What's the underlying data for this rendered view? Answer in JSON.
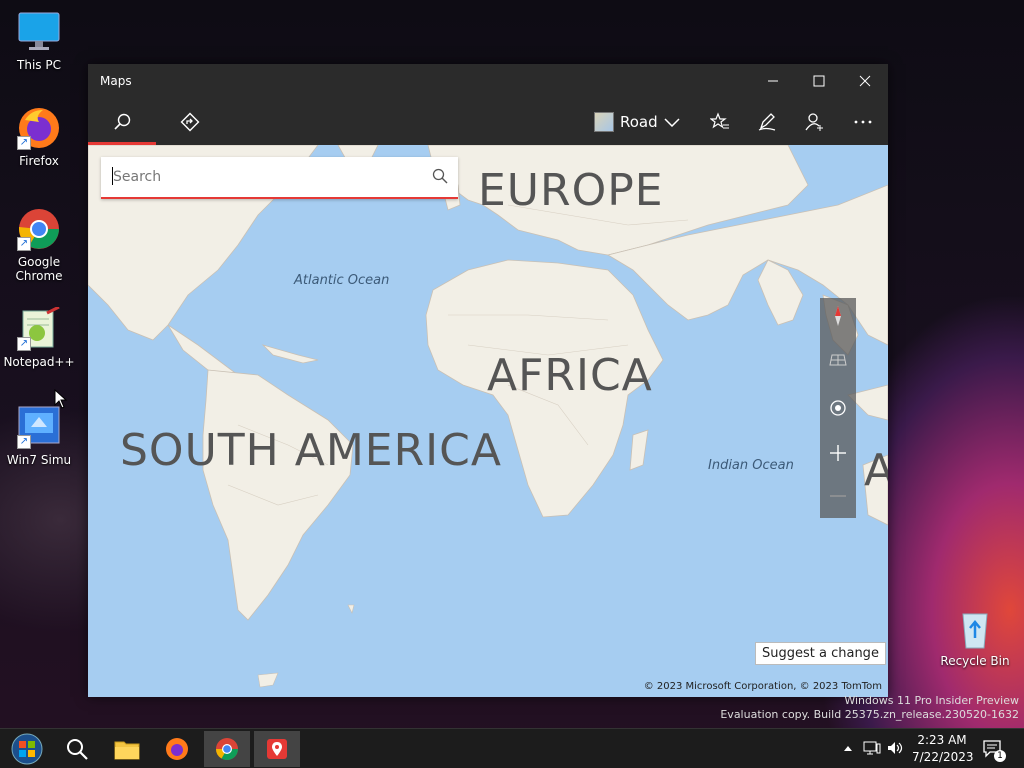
{
  "desktop": {
    "icons": [
      {
        "label": "This PC"
      },
      {
        "label": "Firefox"
      },
      {
        "label": "Google Chrome"
      },
      {
        "label": "Notepad++"
      },
      {
        "label": "Win7 Simu"
      },
      {
        "label": "Recycle Bin"
      }
    ],
    "watermark_line1": "Windows 11 Pro Insider Preview",
    "watermark_line2": "Evaluation copy. Build 25375.zn_release.230520-1632"
  },
  "window": {
    "title": "Maps",
    "toolbar": {
      "map_style": "Road"
    },
    "search": {
      "placeholder": "Search",
      "value": ""
    },
    "map_labels": {
      "europe": "EUROPE",
      "africa": "AFRICA",
      "south_america": "SOUTH AMERICA",
      "australia_partial": "AU",
      "atlantic": "Atlantic Ocean",
      "indian": "Indian Ocean"
    },
    "suggest_button": "Suggest a change",
    "copyright": "© 2023 Microsoft Corporation, © 2023 TomTom"
  },
  "taskbar": {
    "time": "2:23 AM",
    "date": "7/22/2023",
    "notification_count": "1"
  },
  "colors": {
    "accent_red": "#e53935",
    "map_water": "#a6cdf1",
    "map_land": "#f2efe6",
    "window_chrome": "#2b2b2b"
  }
}
